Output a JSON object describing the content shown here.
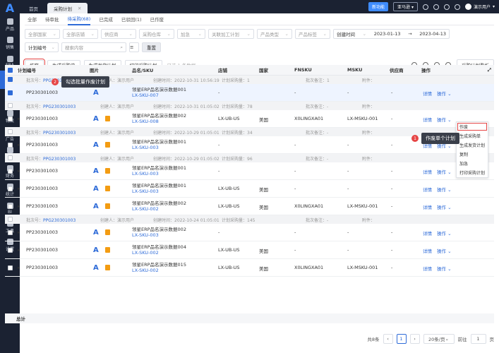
{
  "sidebar": {
    "logo": "A",
    "items": [
      {
        "label": "产品"
      },
      {
        "label": "销售"
      },
      {
        "label": "FBA"
      },
      {
        "label": "采购"
      },
      {
        "label": "仓库"
      },
      {
        "label": "物流"
      },
      {
        "label": "广告"
      },
      {
        "label": "客服"
      },
      {
        "label": "财务"
      },
      {
        "label": "统计"
      },
      {
        "label": "BI"
      },
      {
        "label": "工具"
      },
      {
        "label": "设置"
      }
    ]
  },
  "topbar": {
    "tabs": [
      {
        "label": "首页"
      },
      {
        "label": "采购计划"
      }
    ],
    "new_label": "新功能",
    "account": "亚马逊",
    "user": "演示用户"
  },
  "subtabs": [
    {
      "label": "全部"
    },
    {
      "label": "待审批"
    },
    {
      "label": "待采购(68)"
    },
    {
      "label": "已完成"
    },
    {
      "label": "已驳回(1)"
    },
    {
      "label": "已作废"
    }
  ],
  "filters": {
    "row1": [
      "全部国家",
      "全部店铺",
      "供应商",
      "采购仓库",
      "加急",
      "关联加工计划",
      "产品类型",
      "产品标签"
    ],
    "date_type": "创建时间",
    "date_from": "2023-01-13",
    "date_sep": "→",
    "date_to": "2023-04-13",
    "plan_field": "计划编号",
    "search_placeholder": "搜索内容",
    "reset": "重置"
  },
  "toolbar": {
    "void": "作废",
    "gen_po": "生成采购单",
    "gen_ship": "生成发货计划",
    "print": "打印采购计划",
    "selected": "已选 1 条数据",
    "board": "采购计划看板"
  },
  "headers": {
    "plan": "计划编号",
    "image": "图片",
    "product": "品名/SKU",
    "shop": "店铺",
    "country": "国家",
    "fnsku": "FNSKU",
    "msku": "MSKU",
    "supplier": "供应商",
    "op": "操作"
  },
  "groups": [
    {
      "batch": "批次号：",
      "batch_no": "PPG230301003",
      "creator": "创建人：演示用户",
      "time": "创建时间：2022-10-31 10:56:19",
      "count": "计划采购量：1",
      "note": "批次备注：1",
      "attach": "附件："
    },
    {
      "batch": "批次号：",
      "batch_no": "PPG230301003",
      "creator": "创建人：演示用户",
      "time": "创建时间：2022-10-31 01:05:02",
      "count": "计划采购量：78",
      "note": "批次备注：-",
      "attach": "附件："
    },
    {
      "batch": "批次号：",
      "batch_no": "PPG230301003",
      "creator": "创建人：演示用户",
      "time": "创建时间：2022-10-29 01:05:01",
      "count": "计划采购量：34",
      "note": "批次备注：-",
      "attach": "附件："
    },
    {
      "batch": "批次号：",
      "batch_no": "PPG230301003",
      "creator": "创建人：演示用户",
      "time": "创建时间：2022-10-29 01:05:02",
      "count": "计划采购量：96",
      "note": "批次备注：-",
      "attach": "附件："
    },
    {
      "batch": "批次号：",
      "batch_no": "PPG230301003",
      "creator": "创建人：演示用户",
      "time": "创建时间：2022-10-24 01:05:01",
      "count": "计划采购量：145",
      "note": "批次备注：-",
      "attach": "附件："
    }
  ],
  "rows": [
    {
      "plan": "PP230301003",
      "name": "领星ERP品名演示数据001",
      "sku": "LX-SKU-007",
      "shop": "-",
      "country": "",
      "fnsku": "-",
      "msku": "-",
      "supplier": "-"
    },
    {
      "plan": "PP230301003",
      "name": "领星ERP品名演示数据002",
      "sku": "LX-SKU-008",
      "shop": "LX-UB-US",
      "country": "美国",
      "fnsku": "X0LINGXA01",
      "msku": "LX-MSKU-001",
      "supplier": "-"
    },
    {
      "plan": "PP230301003",
      "name": "领星ERP品名演示数据001",
      "sku": "LX-SKU-003",
      "shop": "-",
      "country": "",
      "fnsku": "-",
      "msku": "-",
      "supplier": "-"
    },
    {
      "plan": "PP230301003",
      "name": "领星ERP品名演示数据001",
      "sku": "LX-SKU-003",
      "shop": "-",
      "country": "",
      "fnsku": "-",
      "msku": "-",
      "supplier": "-"
    },
    {
      "plan": "PP230301003",
      "name": "领星ERP品名演示数据001",
      "sku": "LX-SKU-003",
      "shop": "LX-UB-US",
      "country": "美国",
      "fnsku": "-",
      "msku": "-",
      "supplier": "-"
    },
    {
      "plan": "PP230301003",
      "name": "领星ERP品名演示数据002",
      "sku": "LX-SKU-002",
      "shop": "LX-UB-US",
      "country": "美国",
      "fnsku": "X0LINGXA01",
      "msku": "LX-MSKU-001",
      "supplier": "-"
    },
    {
      "plan": "PP230301003",
      "name": "领星ERP品名演示数据002",
      "sku": "LX-SKU-003",
      "shop": "-",
      "country": "",
      "fnsku": "-",
      "msku": "-",
      "supplier": "-"
    },
    {
      "plan": "PP230301003",
      "name": "领星ERP品名演示数据004",
      "sku": "LX-SKU-002",
      "shop": "LX-UB-US",
      "country": "美国",
      "fnsku": "-",
      "msku": "-",
      "supplier": "-"
    },
    {
      "plan": "PP230301003",
      "name": "领星ERP品名演示数据015",
      "sku": "LX-SKU-002",
      "shop": "LX-UB-US",
      "country": "美国",
      "fnsku": "X0LINGXA01",
      "msku": "LX-MSKU-001",
      "supplier": "-"
    }
  ],
  "row_actions": {
    "detail": "详情",
    "op": "操作 ⌄"
  },
  "dropdown": [
    "作废",
    "生成采购单",
    "生成发货计划",
    "复制",
    "加急",
    "打印采购计划"
  ],
  "tips": {
    "batch": "勾选批量作废计划",
    "single": "作废单个计划",
    "n1": "1",
    "n2": "2"
  },
  "footer": {
    "total": "总计"
  },
  "pager": {
    "total": "共8条",
    "page": "1",
    "size": "20条/页",
    "goto": "前往",
    "goto_val": "1",
    "page_unit": "页",
    "prev": "‹",
    "next": "›"
  }
}
